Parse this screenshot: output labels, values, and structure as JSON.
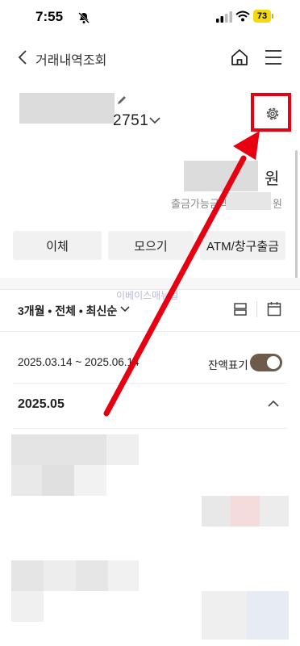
{
  "status_bar": {
    "time": "7:55",
    "battery": "73"
  },
  "header": {
    "title": "거래내역조회"
  },
  "account": {
    "number_suffix": "2751",
    "balance_unit": "원",
    "available_label": "출금가능금액",
    "available_unit": "원"
  },
  "actions": {
    "transfer": "이체",
    "collect": "모으기",
    "atm": "ATM/창구출금"
  },
  "filter": {
    "label": "3개월 • 전체 • 최신순"
  },
  "watermark": "이베이스매뉴얼",
  "period": {
    "range": "2025.03.14 ~ 2025.06.14",
    "balance_toggle_label": "잔액표기",
    "balance_toggle_on": true
  },
  "month_group": {
    "label": "2025.05"
  },
  "colors": {
    "highlight_red": "#e60012",
    "toggle_brown": "#6e5a4b",
    "battery_yellow": "#f5d90a"
  }
}
